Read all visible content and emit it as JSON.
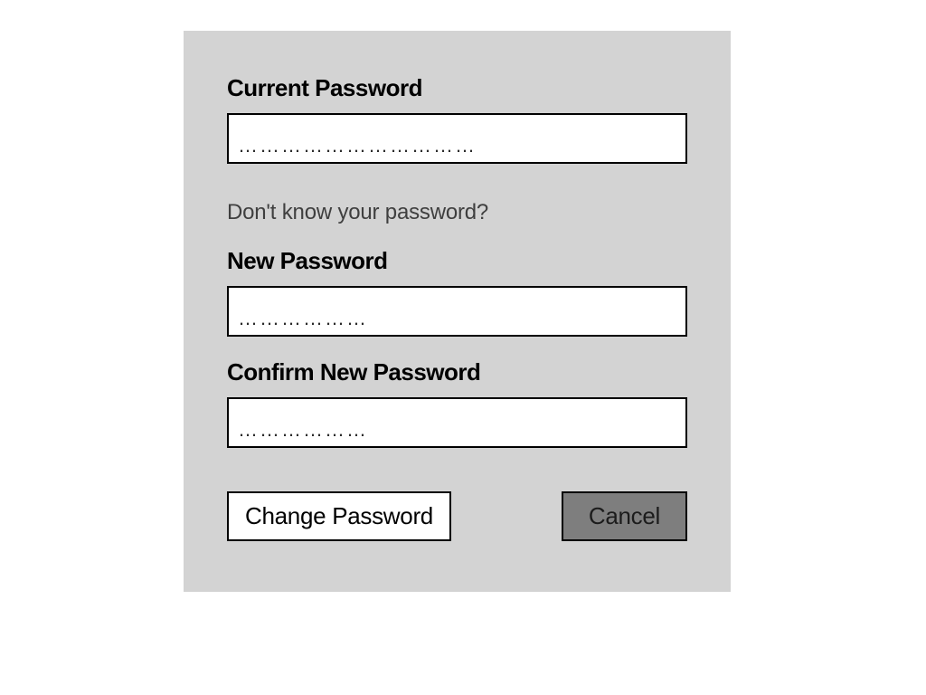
{
  "form": {
    "current_password": {
      "label": "Current Password",
      "value": "……………………………"
    },
    "helper_link": "Don't know your password?",
    "new_password": {
      "label": "New Password",
      "value": "………………"
    },
    "confirm_password": {
      "label": "Confirm New Password",
      "value": "………………"
    }
  },
  "buttons": {
    "submit": "Change Password",
    "cancel": "Cancel"
  }
}
